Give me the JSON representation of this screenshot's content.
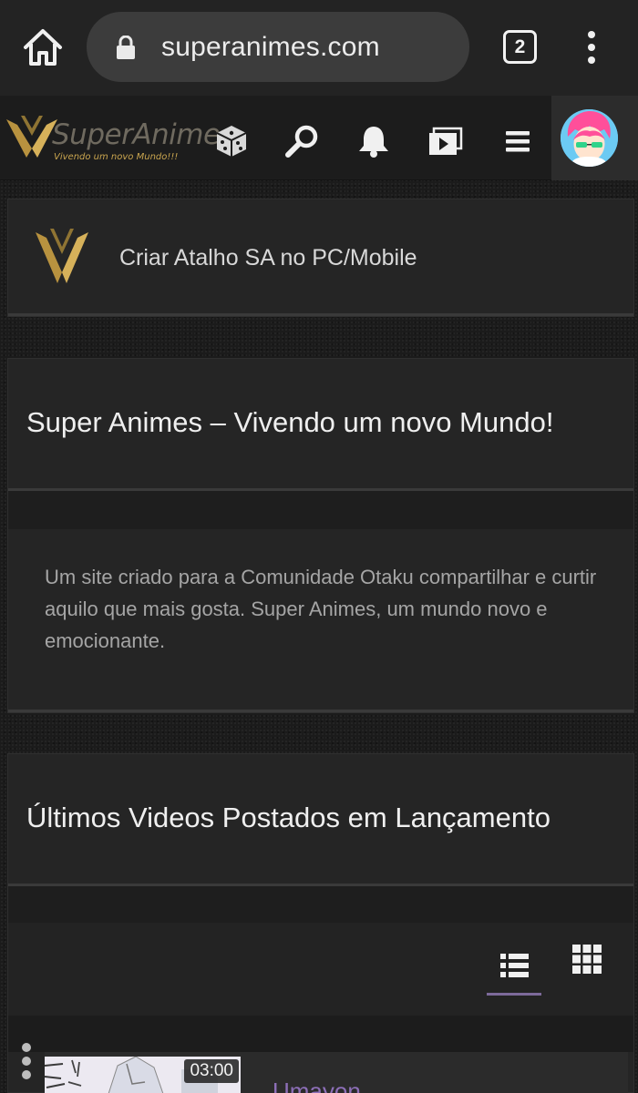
{
  "browser": {
    "url": "superanimes.com",
    "tab_count": "2"
  },
  "header": {
    "logo_title": "SuperAnimes",
    "logo_subtitle": "Vivendo um novo Mundo!!!",
    "icons": [
      "dice-icon",
      "search-icon",
      "bell-icon",
      "video-library-icon",
      "hamburger-menu-icon"
    ]
  },
  "shortcut": {
    "label": "Criar Atalho SA no PC/Mobile"
  },
  "about": {
    "title": "Super Animes – Vivendo um novo Mundo!",
    "description": "Um site criado para a Comunidade Otaku compartilhar e curtir aquilo que mais gosta. Super Animes, um mundo novo e emocionante."
  },
  "videos": {
    "title": "Últimos Videos Postados em Lançamento",
    "items": [
      {
        "duration": "03:00",
        "title": "Umayon"
      }
    ]
  },
  "colors": {
    "page_bg": "#1b1b1b",
    "panel_bg": "#252525",
    "browser_bar": "#232323",
    "gold_accent": "#c9a54f",
    "link_purple": "#8d6fb8"
  }
}
